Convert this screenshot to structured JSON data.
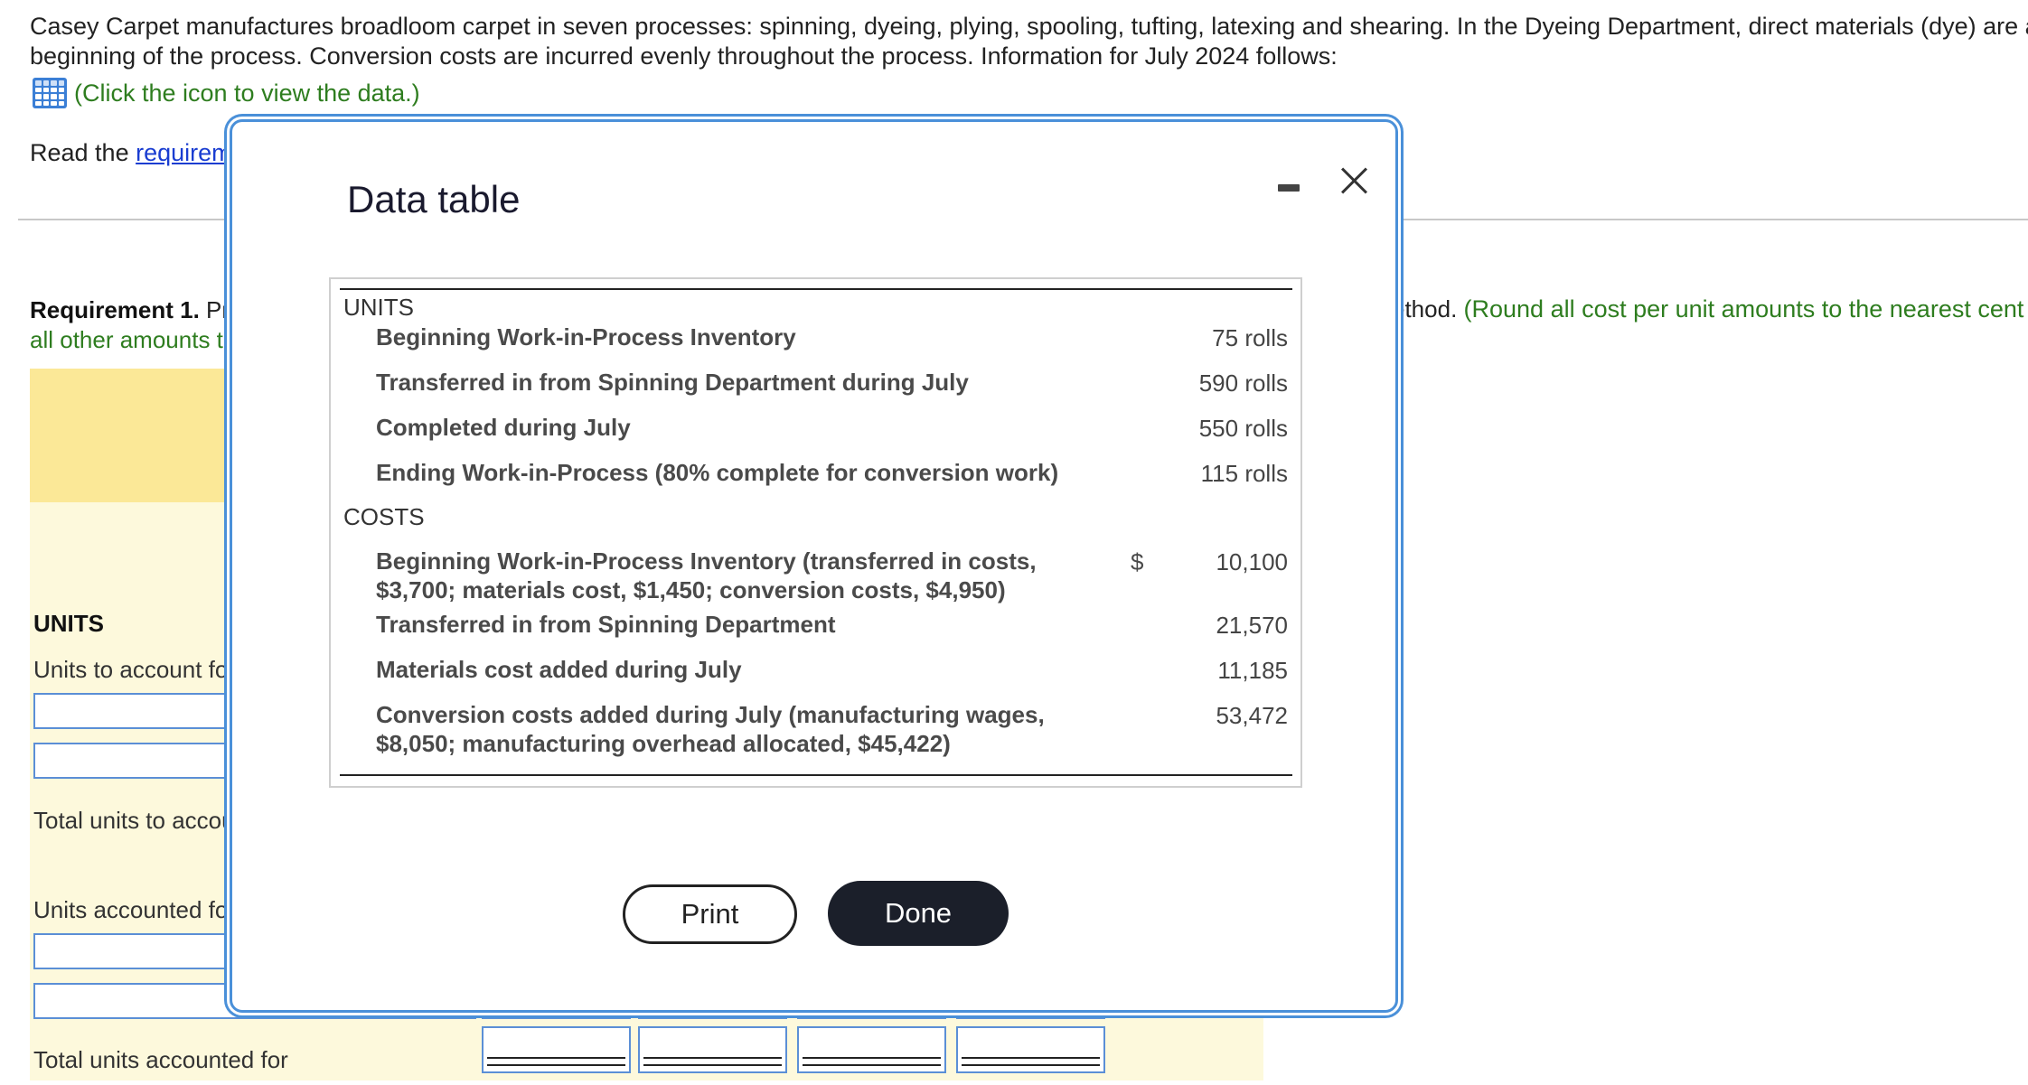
{
  "intro": {
    "line1": "Casey Carpet manufactures broadloom carpet in seven processes: spinning, dyeing, plying, spooling, tufting, latexing and shearing. In the Dyeing Department, direct materials (dye) are added a",
    "line2": "beginning of the process. Conversion costs are incurred evenly throughout the process. Information for July 2024 follows:",
    "data_link": "(Click the icon to view the data.)"
  },
  "read_requirements": {
    "prefix": "Read the ",
    "link": "requirem"
  },
  "requirement1": {
    "label": "Requirement 1.",
    "text_start": " Pr",
    "line2": "all other amounts to",
    "right_plain": "ethod. ",
    "right_green": "(Round all cost per unit amounts to the nearest cent a"
  },
  "worksheet": {
    "units_header": "UNITS",
    "units_to_account_for": "Units to account fo",
    "total_units_to_account": "Total units to accou",
    "units_accounted_for": "Units accounted fo",
    "total_units_accounted_for": "Total units accounted for"
  },
  "modal": {
    "title": "Data table",
    "units_header": "UNITS",
    "units_rows": [
      {
        "label": "Beginning Work-in-Process Inventory",
        "value": "75 rolls"
      },
      {
        "label": "Transferred in from Spinning Department during July",
        "value": "590 rolls"
      },
      {
        "label": "Completed during July",
        "value": "550 rolls"
      },
      {
        "label": "Ending Work-in-Process (80% complete for conversion work)",
        "value": "115 rolls"
      }
    ],
    "costs_header": "COSTS",
    "costs_rows": [
      {
        "label": "Beginning Work-in-Process Inventory (transferred in costs, $3,700; materials cost, $1,450; conversion costs, $4,950)",
        "dollar": "$",
        "value": "10,100"
      },
      {
        "label": "Transferred in from Spinning Department",
        "dollar": "",
        "value": "21,570"
      },
      {
        "label": "Materials cost added during July",
        "dollar": "",
        "value": "11,185"
      },
      {
        "label": "Conversion costs added during July (manufacturing wages, $8,050; manufacturing overhead allocated, $45,422)",
        "dollar": "",
        "value": "53,472"
      }
    ],
    "print_label": "Print",
    "done_label": "Done"
  },
  "colors": {
    "accent_blue": "#4a90d9",
    "link_blue": "#1a3dd1",
    "green_hint": "#2e7d1f",
    "yellow_header": "#fbe897",
    "yellow_body": "#fdf9dc",
    "done_button": "#1b1f2a"
  },
  "icons": {
    "data_table": "table-grid-icon",
    "minimize": "minimize-icon",
    "close": "close-icon"
  }
}
